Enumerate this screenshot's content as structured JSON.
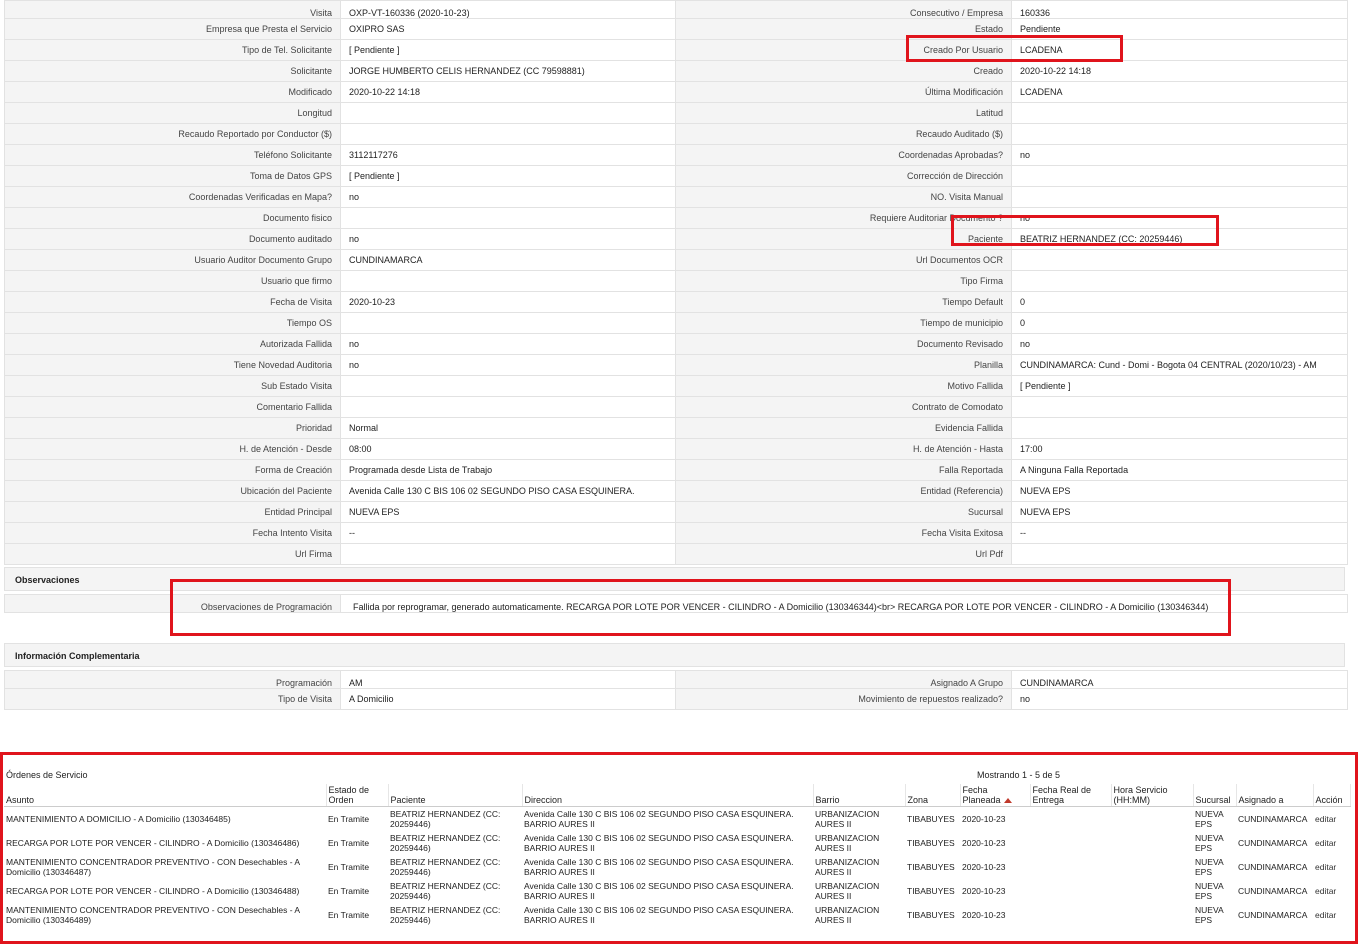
{
  "detail_rows": [
    {
      "l1": "Visita",
      "v1": "OXP-VT-160336 (2020-10-23)",
      "l2": "Consecutivo / Empresa",
      "v2": "160336"
    },
    {
      "l1": "Empresa que Presta el Servicio",
      "v1": "OXIPRO SAS",
      "l2": "Estado",
      "v2": "Pendiente"
    },
    {
      "l1": "Tipo de Tel. Solicitante",
      "v1": "[ Pendiente ]",
      "l2": "Creado Por Usuario",
      "v2": "LCADENA"
    },
    {
      "l1": "Solicitante",
      "v1": "JORGE HUMBERTO CELIS HERNANDEZ (CC 79598881)",
      "l2": "Creado",
      "v2": "2020-10-22 14:18"
    },
    {
      "l1": "Modificado",
      "v1": "2020-10-22 14:18",
      "l2": "Última Modificación",
      "v2": "LCADENA"
    },
    {
      "l1": "Longitud",
      "v1": "",
      "l2": "Latitud",
      "v2": ""
    },
    {
      "l1": "Recaudo Reportado por Conductor ($)",
      "v1": "",
      "l2": "Recaudo Auditado ($)",
      "v2": ""
    },
    {
      "l1": "Teléfono Solicitante",
      "v1": "3112117276",
      "l2": "Coordenadas Aprobadas?",
      "v2": "no"
    },
    {
      "l1": "Toma de Datos GPS",
      "v1": "[ Pendiente ]",
      "l2": "Corrección de Dirección",
      "v2": ""
    },
    {
      "l1": "Coordenadas Verificadas en Mapa?",
      "v1": "no",
      "l2": "NO. Visita Manual",
      "v2": ""
    },
    {
      "l1": "Documento fisico",
      "v1": "",
      "l2": "Requiere Auditoriar Documento ?",
      "v2": "no"
    },
    {
      "l1": "Documento auditado",
      "v1": "no",
      "l2": "Paciente",
      "v2": "BEATRIZ HERNANDEZ (CC: 20259446)"
    },
    {
      "l1": "Usuario Auditor Documento Grupo",
      "v1": "CUNDINAMARCA",
      "l2": "Url Documentos OCR",
      "v2": ""
    },
    {
      "l1": "Usuario que firmo",
      "v1": "",
      "l2": "Tipo Firma",
      "v2": ""
    },
    {
      "l1": "Fecha de Visita",
      "v1": "2020-10-23",
      "l2": "Tiempo Default",
      "v2": "0"
    },
    {
      "l1": "Tiempo OS",
      "v1": "",
      "l2": "Tiempo de municipio",
      "v2": "0"
    },
    {
      "l1": "Autorizada Fallida",
      "v1": "no",
      "l2": "Documento Revisado",
      "v2": "no"
    },
    {
      "l1": "Tiene Novedad Auditoria",
      "v1": "no",
      "l2": "Planilla",
      "v2": "CUNDINAMARCA: Cund - Domi - Bogota 04 CENTRAL (2020/10/23) - AM"
    },
    {
      "l1": "Sub Estado Visita",
      "v1": "",
      "l2": "Motivo Fallida",
      "v2": "[ Pendiente ]"
    },
    {
      "l1": "Comentario Fallida",
      "v1": "",
      "l2": "Contrato de Comodato",
      "v2": ""
    },
    {
      "l1": "Prioridad",
      "v1": "Normal",
      "l2": "Evidencia Fallida",
      "v2": ""
    },
    {
      "l1": "H. de Atención - Desde",
      "v1": "08:00",
      "l2": "H. de Atención - Hasta",
      "v2": "17:00"
    },
    {
      "l1": "Forma de Creación",
      "v1": "Programada desde Lista de Trabajo",
      "l2": "Falla Reportada",
      "v2": "A Ninguna Falla Reportada"
    },
    {
      "l1": "Ubicación del Paciente",
      "v1": "Avenida Calle 130 C BIS 106 02 SEGUNDO PISO CASA ESQUINERA.",
      "l2": "Entidad (Referencia)",
      "v2": "NUEVA EPS"
    },
    {
      "l1": "Entidad Principal",
      "v1": "NUEVA EPS",
      "l2": "Sucursal",
      "v2": "NUEVA EPS"
    },
    {
      "l1": "Fecha Intento Visita",
      "v1": "--",
      "l2": "Fecha Visita Exitosa",
      "v2": "--"
    },
    {
      "l1": "Url Firma",
      "v1": "",
      "l2": "Url Pdf",
      "v2": ""
    }
  ],
  "observaciones": {
    "title": "Observaciones",
    "label": "Observaciones de Programación",
    "value": "Fallida por reprogramar, generado automaticamente. RECARGA POR LOTE POR VENCER - CILINDRO - A Domicilio (130346344)<br> RECARGA POR LOTE POR VENCER - CILINDRO - A Domicilio (130346344)"
  },
  "info_complementaria": {
    "title": "Información Complementaria",
    "rows": [
      {
        "l1": "Programación",
        "v1": "AM",
        "l2": "Asignado A Grupo",
        "v2": "CUNDINAMARCA"
      },
      {
        "l1": "Tipo de Visita",
        "v1": "A Domicilio",
        "l2": "Movimiento de repuestos realizado?",
        "v2": "no"
      }
    ]
  },
  "ordenes": {
    "title": "Órdenes de Servicio",
    "count_text": "Mostrando 1 - 5 de 5",
    "columns": [
      "Asunto",
      "Estado de Orden",
      "Paciente",
      "Direccion",
      "Barrio",
      "Zona",
      "Fecha Planeada",
      "Fecha Real de Entrega",
      "Hora Servicio (HH:MM)",
      "Sucursal",
      "Asignado a",
      "Acción"
    ],
    "rows": [
      {
        "asunto": "MANTENIMIENTO A DOMICILIO - A Domicilio (130346485)",
        "estado": "En Tramite",
        "paciente": "BEATRIZ HERNANDEZ (CC: 20259446)",
        "direccion": "Avenida Calle 130 C BIS 106 02 SEGUNDO PISO CASA ESQUINERA. BARRIO AURES II",
        "barrio": "URBANIZACION AURES II",
        "zona": "TIBABUYES",
        "fecha": "2020-10-23",
        "fecha_real": "",
        "hora": "",
        "sucursal": "NUEVA EPS",
        "asignado": "CUNDINAMARCA",
        "accion": "editar"
      },
      {
        "asunto": "RECARGA POR LOTE POR VENCER - CILINDRO - A Domicilio (130346486)",
        "estado": "En Tramite",
        "paciente": "BEATRIZ HERNANDEZ (CC: 20259446)",
        "direccion": "Avenida Calle 130 C BIS 106 02 SEGUNDO PISO CASA ESQUINERA. BARRIO AURES II",
        "barrio": "URBANIZACION AURES II",
        "zona": "TIBABUYES",
        "fecha": "2020-10-23",
        "fecha_real": "",
        "hora": "",
        "sucursal": "NUEVA EPS",
        "asignado": "CUNDINAMARCA",
        "accion": "editar"
      },
      {
        "asunto": "MANTENIMIENTO CONCENTRADOR PREVENTIVO - CON Desechables - A Domicilio (130346487)",
        "estado": "En Tramite",
        "paciente": "BEATRIZ HERNANDEZ (CC: 20259446)",
        "direccion": "Avenida Calle 130 C BIS 106 02 SEGUNDO PISO CASA ESQUINERA. BARRIO AURES II",
        "barrio": "URBANIZACION AURES II",
        "zona": "TIBABUYES",
        "fecha": "2020-10-23",
        "fecha_real": "",
        "hora": "",
        "sucursal": "NUEVA EPS",
        "asignado": "CUNDINAMARCA",
        "accion": "editar"
      },
      {
        "asunto": "RECARGA POR LOTE POR VENCER - CILINDRO - A Domicilio (130346488)",
        "estado": "En Tramite",
        "paciente": "BEATRIZ HERNANDEZ (CC: 20259446)",
        "direccion": "Avenida Calle 130 C BIS 106 02 SEGUNDO PISO CASA ESQUINERA. BARRIO AURES II",
        "barrio": "URBANIZACION AURES II",
        "zona": "TIBABUYES",
        "fecha": "2020-10-23",
        "fecha_real": "",
        "hora": "",
        "sucursal": "NUEVA EPS",
        "asignado": "CUNDINAMARCA",
        "accion": "editar"
      },
      {
        "asunto": "MANTENIMIENTO CONCENTRADOR PREVENTIVO - CON Desechables - A Domicilio (130346489)",
        "estado": "En Tramite",
        "paciente": "BEATRIZ HERNANDEZ (CC: 20259446)",
        "direccion": "Avenida Calle 130 C BIS 106 02 SEGUNDO PISO CASA ESQUINERA. BARRIO AURES II",
        "barrio": "URBANIZACION AURES II",
        "zona": "TIBABUYES",
        "fecha": "2020-10-23",
        "fecha_real": "",
        "hora": "",
        "sucursal": "NUEVA EPS",
        "asignado": "CUNDINAMARCA",
        "accion": "editar"
      }
    ]
  },
  "colors": {
    "highlight": "#e0141c",
    "label_bg": "#f4f4f4",
    "border": "#e2e2e2",
    "sort_arrow": "#c0392b"
  }
}
